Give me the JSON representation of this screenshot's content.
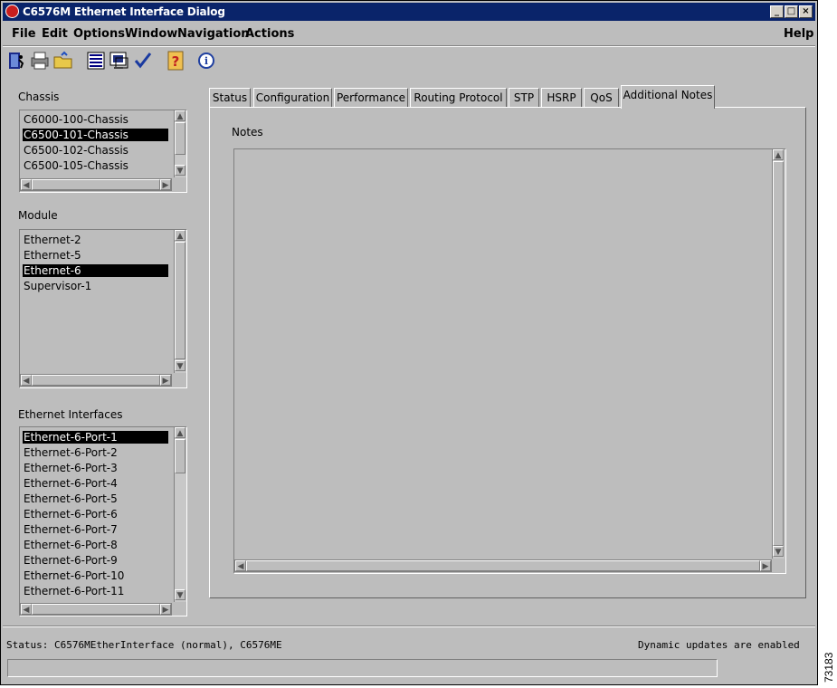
{
  "window": {
    "title": "C6576M Ethernet Interface Dialog",
    "minimize": "_",
    "maximize": "□",
    "close": "×"
  },
  "menu": {
    "file": "File",
    "edit": "Edit",
    "options": "Options",
    "window": "Window",
    "navigation": "Navigation",
    "actions": "Actions",
    "help": "Help"
  },
  "toolbar": [
    "exit-icon",
    "print-icon",
    "open-folder-icon",
    "list-icon",
    "monitor-icon",
    "check-icon",
    "help-icon",
    "info-icon"
  ],
  "chassis": {
    "label": "Chassis",
    "items": [
      "C6000-100-Chassis",
      "C6500-101-Chassis",
      "C6500-102-Chassis",
      "C6500-105-Chassis"
    ],
    "selected_index": 1
  },
  "module": {
    "label": "Module",
    "items": [
      "Ethernet-2",
      "Ethernet-5",
      "Ethernet-6",
      "Supervisor-1"
    ],
    "selected_index": 2
  },
  "interfaces": {
    "label": "Ethernet Interfaces",
    "items": [
      "Ethernet-6-Port-1",
      "Ethernet-6-Port-2",
      "Ethernet-6-Port-3",
      "Ethernet-6-Port-4",
      "Ethernet-6-Port-5",
      "Ethernet-6-Port-6",
      "Ethernet-6-Port-7",
      "Ethernet-6-Port-8",
      "Ethernet-6-Port-9",
      "Ethernet-6-Port-10",
      "Ethernet-6-Port-11"
    ],
    "selected_index": 0
  },
  "tabs": [
    "Status",
    "Configuration",
    "Performance",
    "Routing Protocol",
    "STP",
    "HSRP",
    "QoS",
    "Additional Notes"
  ],
  "active_tab": "Additional Notes",
  "notes": {
    "label": "Notes",
    "value": ""
  },
  "status": {
    "text": "Status: C6576MEtherInterface (normal), C6576ME",
    "updates": "Dynamic updates are enabled"
  },
  "figure_number": "73183"
}
